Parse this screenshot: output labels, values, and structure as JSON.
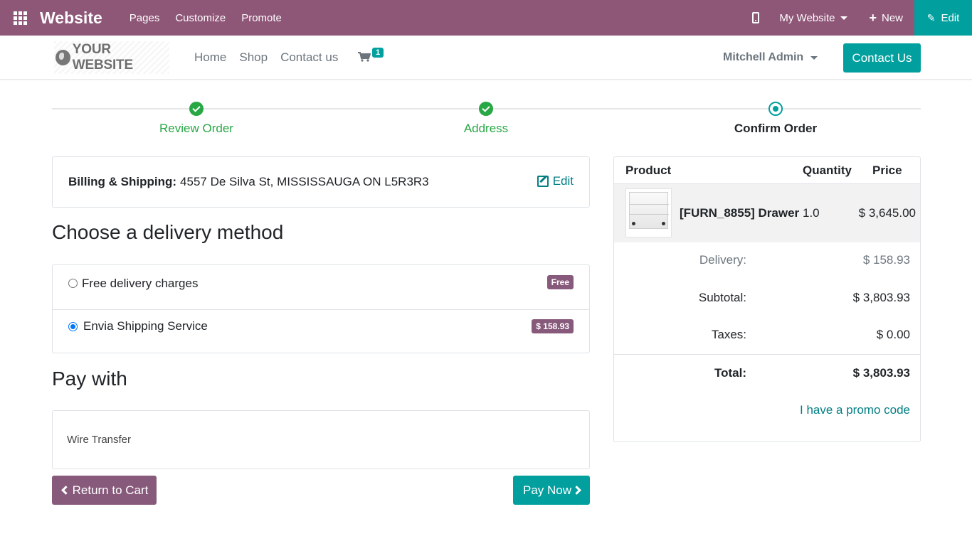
{
  "admin": {
    "title": "Website",
    "menu": [
      "Pages",
      "Customize",
      "Promote"
    ],
    "my_website": "My Website",
    "new_label": "New",
    "edit_label": "Edit"
  },
  "sitenav": {
    "logo_text": "YOUR WEBSITE",
    "links": [
      "Home",
      "Shop",
      "Contact us"
    ],
    "cart_count": "1",
    "user": "Mitchell Admin",
    "contact_button": "Contact Us"
  },
  "wizard": {
    "steps": [
      {
        "label": "Review Order",
        "state": "done"
      },
      {
        "label": "Address",
        "state": "done"
      },
      {
        "label": "Confirm Order",
        "state": "current"
      }
    ]
  },
  "billing": {
    "label": "Billing & Shipping:",
    "address": "4557 De Silva St, MISSISSAUGA ON L5R3R3",
    "edit_label": "Edit"
  },
  "delivery": {
    "heading": "Choose a delivery method",
    "options": [
      {
        "name": "Free delivery charges",
        "price": "Free",
        "selected": false
      },
      {
        "name": "Envia Shipping Service",
        "price": "$ 158.93",
        "selected": true
      }
    ]
  },
  "payment": {
    "heading": "Pay with",
    "method": "Wire Transfer",
    "return_button": "Return to Cart",
    "pay_button": "Pay Now"
  },
  "summary": {
    "headers": {
      "product": "Product",
      "quantity": "Quantity",
      "price": "Price"
    },
    "line": {
      "name": "[FURN_8855] Drawer",
      "quantity": "1.0",
      "price": "$ 3,645.00"
    },
    "delivery_label": "Delivery:",
    "delivery_value": "$ 158.93",
    "subtotal_label": "Subtotal:",
    "subtotal_value": "$ 3,803.93",
    "taxes_label": "Taxes:",
    "taxes_value": "$ 0.00",
    "total_label": "Total:",
    "total_value": "$ 3,803.93",
    "promo_label": "I have a promo code"
  },
  "colors": {
    "admin_bar": "#8e5677",
    "teal": "#01a09e",
    "success": "#28a745",
    "secondary_button": "#875a7b"
  }
}
